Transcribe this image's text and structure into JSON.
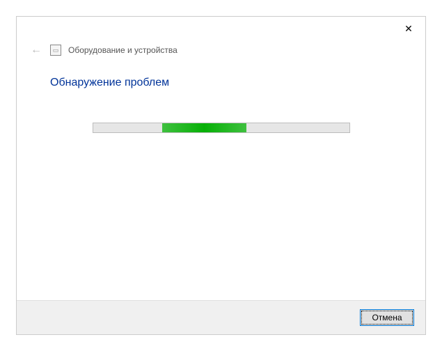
{
  "titlebar": {
    "close_label": "✕"
  },
  "header": {
    "back_glyph": "←",
    "icon_glyph": "▭",
    "title": "Оборудование и устройства"
  },
  "content": {
    "heading": "Обнаружение проблем",
    "progress": {
      "left_percent": "27%",
      "width_percent": "33%"
    }
  },
  "footer": {
    "cancel_label": "Отмена"
  }
}
